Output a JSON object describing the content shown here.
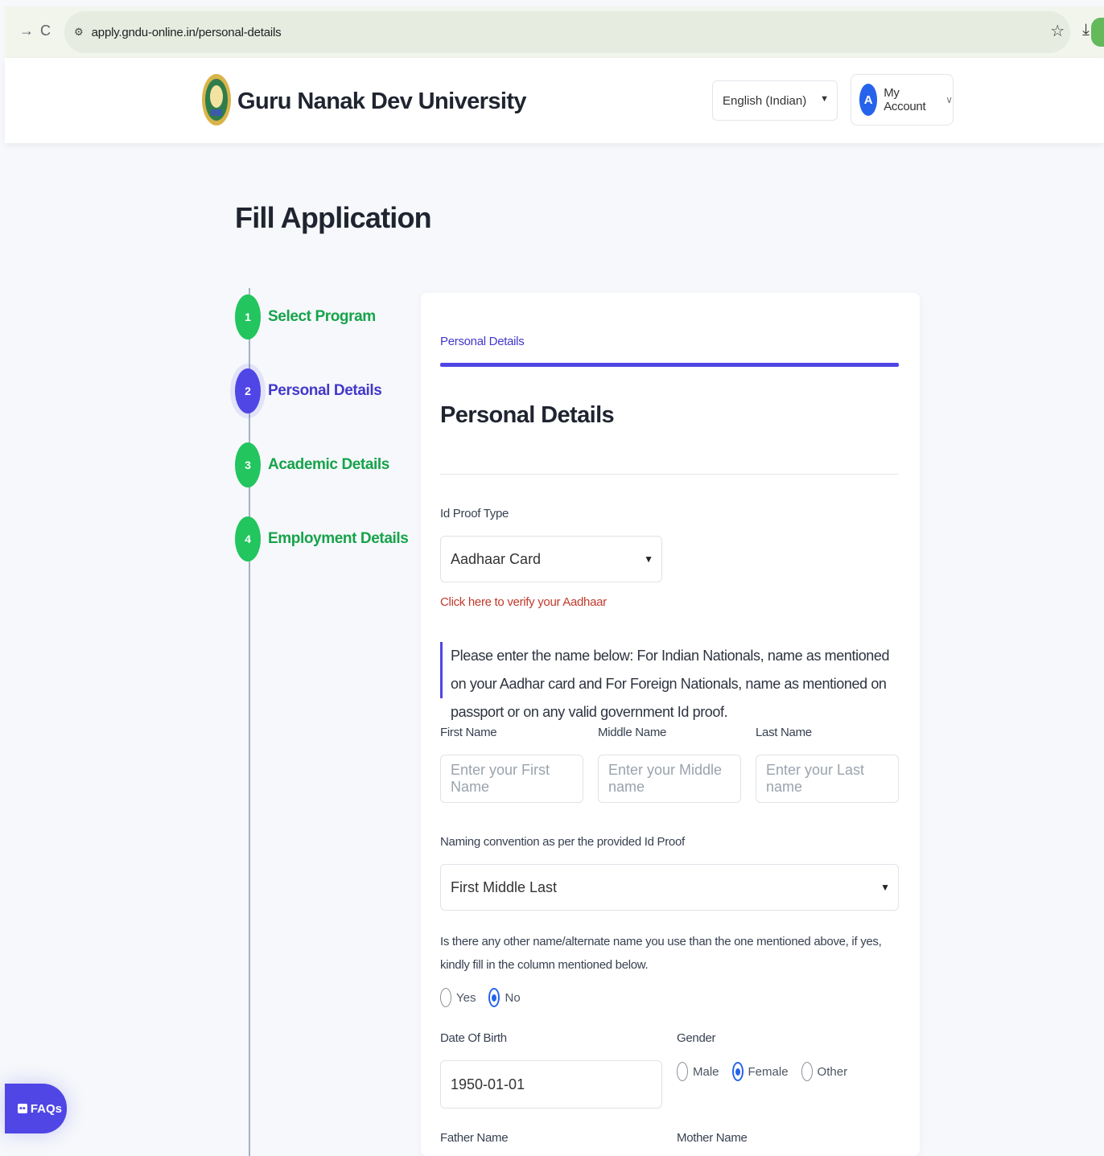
{
  "browser": {
    "url": "apply.gndu-online.in/personal-details"
  },
  "header": {
    "university_name": "Guru Nanak Dev University",
    "language": "English (Indian)",
    "avatar_letter": "A",
    "account_label": "My Account"
  },
  "page": {
    "title": "Fill Application"
  },
  "steps": [
    {
      "number": "1",
      "label": "Select Program",
      "state": "done"
    },
    {
      "number": "2",
      "label": "Personal Details",
      "state": "active"
    },
    {
      "number": "3",
      "label": "Academic Details",
      "state": "done"
    },
    {
      "number": "4",
      "label": "Employment Details",
      "state": "done"
    }
  ],
  "form": {
    "tab_label": "Personal Details",
    "section_title": "Personal Details",
    "id_proof_label": "Id Proof Type",
    "id_proof_value": "Aadhaar Card",
    "verify_link": "Click here to verify your Aadhaar",
    "name_note": "Please enter the name below: For Indian Nationals, name as mentioned on your Aadhar card and For Foreign Nationals, name as mentioned on passport or on any valid government Id proof.",
    "first_name_label": "First Name",
    "first_name_placeholder": "Enter your First Name",
    "middle_name_label": "Middle Name",
    "middle_name_placeholder": "Enter your Middle name",
    "last_name_label": "Last Name",
    "last_name_placeholder": "Enter your Last name",
    "naming_label": "Naming convention as per the provided Id Proof",
    "naming_value": "First Middle Last",
    "alt_name_question": "Is there any other name/alternate name you use than the one mentioned above, if yes, kindly fill in the column mentioned below.",
    "alt_name_options": [
      "Yes",
      "No"
    ],
    "alt_name_selected": "No",
    "dob_label": "Date Of Birth",
    "dob_value": "1950-01-01",
    "gender_label": "Gender",
    "gender_options": [
      "Male",
      "Female",
      "Other"
    ],
    "gender_selected": "Female",
    "father_label": "Father Name",
    "mother_label": "Mother Name"
  },
  "faq": {
    "label": "FAQs"
  },
  "colors": {
    "accent": "#4f46e5",
    "step_done": "#22c55e",
    "link_red": "#c0392b"
  }
}
